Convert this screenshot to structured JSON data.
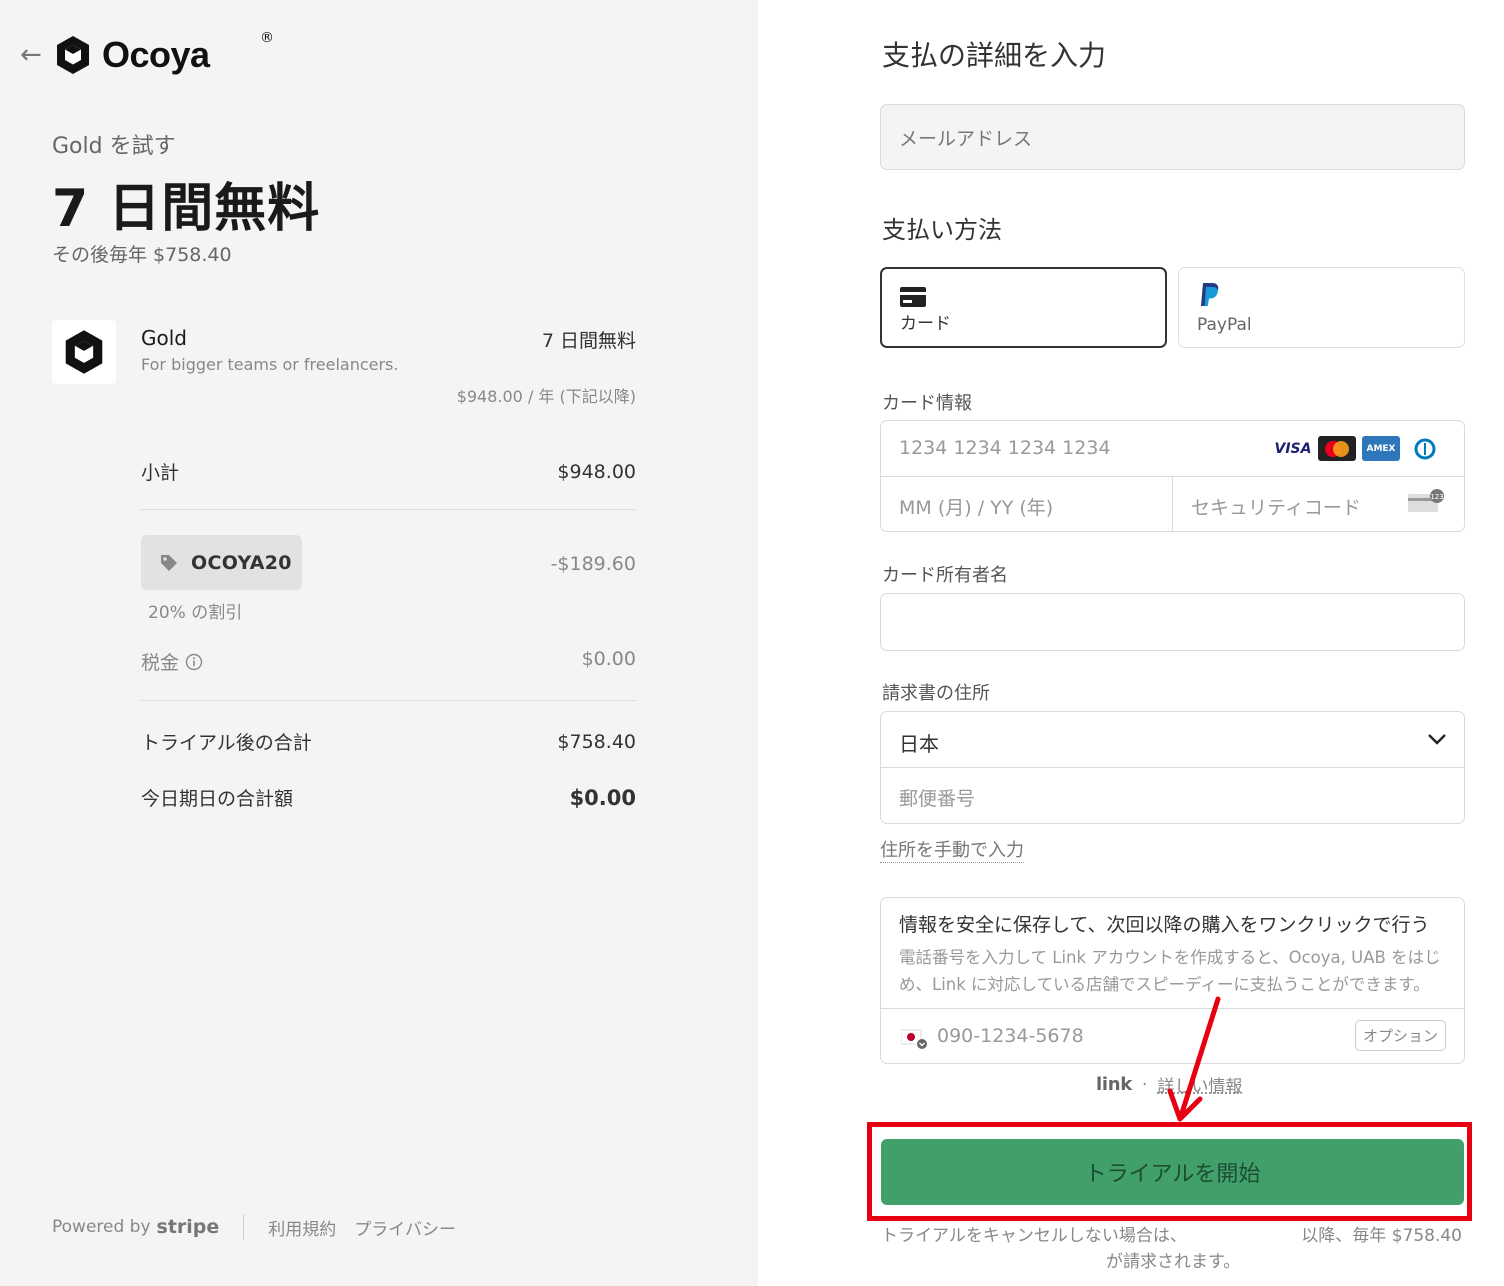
{
  "summary": {
    "back_icon": "arrow-left-icon",
    "brand": "Ocoya",
    "brand_mark": "®",
    "trial_label": "Gold を試す",
    "trial_headline": "7 日間無料",
    "after_price": "その後毎年 $758.40",
    "product": {
      "name": "Gold",
      "description": "For bigger teams or freelancers.",
      "price": "7 日間無料",
      "sub_price": "$948.00 / 年 (下記以降)"
    },
    "subtotal": {
      "label": "小計",
      "value": "$948.00"
    },
    "coupon": {
      "code": "OCOYA20",
      "amount": "-$189.60",
      "note": "20% の割引"
    },
    "tax": {
      "label": "税金",
      "value": "$0.00"
    },
    "total_after_trial": {
      "label": "トライアル後の合計",
      "value": "$758.40"
    },
    "due_today": {
      "label": "今日期日の合計額",
      "value": "$0.00"
    }
  },
  "footer": {
    "powered_by": "Powered by",
    "stripe": "stripe",
    "terms": "利用規約",
    "privacy": "プライバシー"
  },
  "payment": {
    "title": "支払の詳細を入力",
    "email_placeholder": "メールアドレス",
    "method_title": "支払い方法",
    "methods": [
      {
        "label": "カード",
        "icon": "credit-card-icon",
        "selected": true
      },
      {
        "label": "PayPal",
        "icon": "paypal-icon",
        "selected": false
      }
    ],
    "card_info_label": "カード情報",
    "card_number_placeholder": "1234 1234 1234 1234",
    "card_brands": [
      "VISA",
      "mastercard",
      "amex",
      "diners"
    ],
    "expiry_placeholder": "MM (月) / YY (年)",
    "cvc_placeholder": "セキュリティコード",
    "cardholder_label": "カード所有者名",
    "cardholder_value": "",
    "address_label": "請求書の住所",
    "country": "日本",
    "postal_placeholder": "郵便番号",
    "manual_address": "住所を手動で入力",
    "link": {
      "title": "情報を安全に保存して、次回以降の購入をワンクリックで行う",
      "description": "電話番号を入力して Link アカウントを作成すると、Ocoya, UAB をはじめ、Link に対応している店舗でスピーディーに支払うことができます。",
      "phone_placeholder": "090-1234-5678",
      "optional": "オプション",
      "brand": "link",
      "dot": "·",
      "more_info": "詳しい情報"
    },
    "submit": "トライアルを開始",
    "legal_left": "トライアルをキャンセルしない場合は、",
    "legal_right": "以降、毎年 $758.40",
    "legal_bottom": "が請求されます。"
  },
  "colors": {
    "accent_green": "#41a06a",
    "highlight_red": "#e60012",
    "panel_grey": "#f4f4f4"
  }
}
